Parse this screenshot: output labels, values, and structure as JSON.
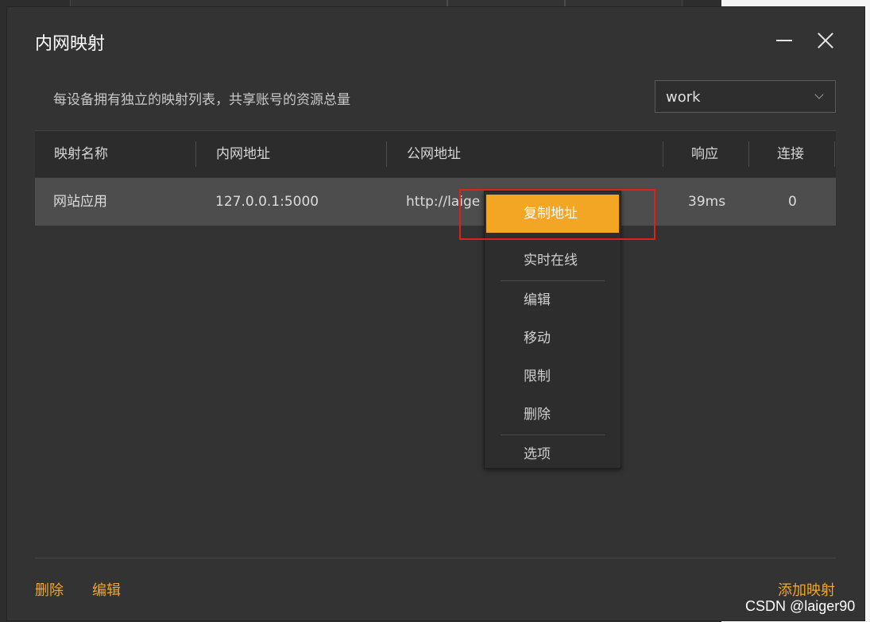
{
  "dialog": {
    "title": "内网映射",
    "description": "每设备拥有独立的映射列表，共享账号的资源总量",
    "device_select": {
      "value": "work"
    }
  },
  "table": {
    "headers": [
      "映射名称",
      "内网地址",
      "公网地址",
      "响应",
      "连接"
    ],
    "rows": [
      {
        "name": "网站应用",
        "local": "127.0.0.1:5000",
        "public": "http://laige",
        "latency": "39ms",
        "connections": "0"
      }
    ]
  },
  "context_menu": {
    "items": [
      "复制地址",
      "实时在线",
      "编辑",
      "移动",
      "限制",
      "删除",
      "选项"
    ],
    "active": "复制地址"
  },
  "footer": {
    "delete_label": "删除",
    "edit_label": "编辑",
    "add_label": "添加映射"
  },
  "watermark": "CSDN @laiger90",
  "colors": {
    "accent": "#f2a623",
    "dialog_bg": "#333333",
    "row_bg": "#4d4d4d",
    "annotation": "#e0201a"
  }
}
